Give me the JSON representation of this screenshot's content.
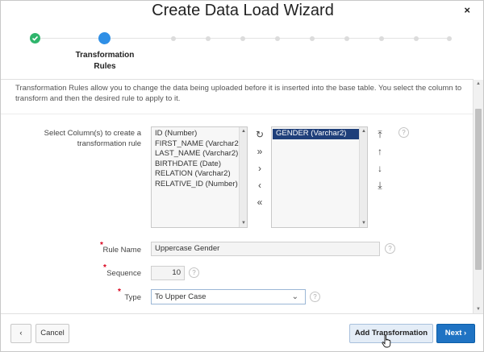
{
  "dialog": {
    "title": "Create Data Load Wizard",
    "close_glyph": "×"
  },
  "wizard": {
    "current_step_label": "Transformation Rules",
    "steps": [
      {
        "state": "done"
      },
      {
        "state": "current"
      },
      {
        "state": "future"
      },
      {
        "state": "future"
      },
      {
        "state": "future"
      },
      {
        "state": "future"
      },
      {
        "state": "future"
      },
      {
        "state": "future"
      },
      {
        "state": "future"
      }
    ]
  },
  "description": "Transformation Rules allow you to change the data being uploaded before it is inserted into the base table. You select the column to transform and then the desired rule to apply to it.",
  "columns_field": {
    "label": "Select Column(s) to create a transformation rule",
    "available": [
      "ID (Number)",
      "FIRST_NAME (Varchar2)",
      "LAST_NAME (Varchar2)",
      "BIRTHDATE (Date)",
      "RELATION (Varchar2)",
      "RELATIVE_ID (Number)"
    ],
    "selected": [
      "GENDER (Varchar2)"
    ],
    "shuttle_buttons": [
      "reset",
      "move-all",
      "move",
      "remove",
      "remove-all"
    ],
    "order_buttons": [
      "top",
      "up",
      "down",
      "bottom"
    ]
  },
  "rule_name": {
    "label": "Rule Name",
    "value": "Uppercase Gender"
  },
  "sequence": {
    "label": "Sequence",
    "value": "10"
  },
  "type": {
    "label": "Type",
    "value": "To Upper Case"
  },
  "help_glyph": "?",
  "footer": {
    "cancel_label": "Cancel",
    "add_label": "Add Transformation",
    "next_label": "Next"
  },
  "colors": {
    "done": "#2fb56c",
    "current": "#2f8fe6",
    "primary": "#1f73c3",
    "required": "#d9001b"
  }
}
